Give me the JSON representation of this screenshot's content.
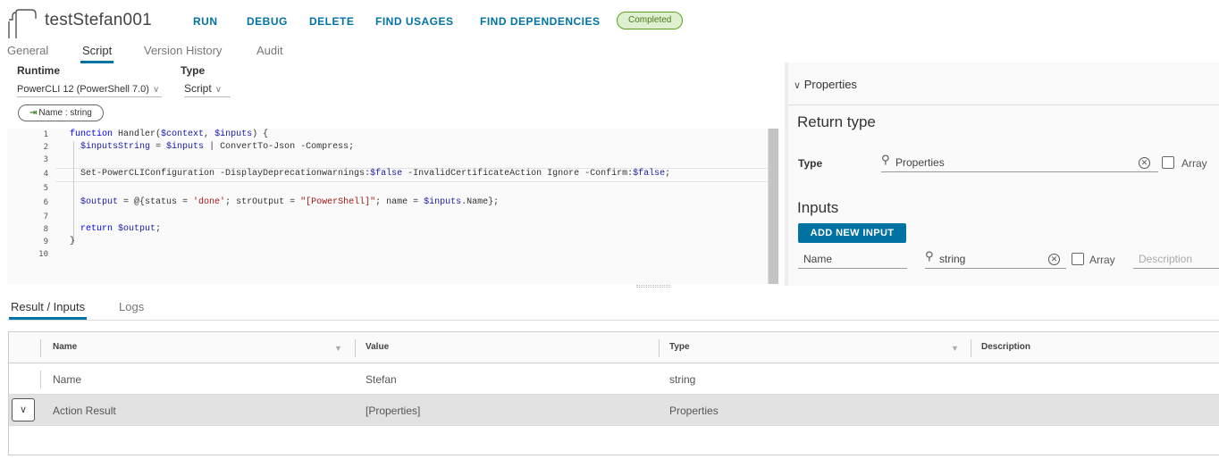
{
  "header": {
    "title": "testStefan001",
    "buttons": [
      "RUN",
      "DEBUG",
      "DELETE",
      "FIND USAGES",
      "FIND DEPENDENCIES"
    ],
    "status": "Completed",
    "icon": "document-icon"
  },
  "tabs": [
    "General",
    "Script",
    "Version History",
    "Audit"
  ],
  "config": {
    "runtime_label": "Runtime",
    "runtime_value": "PowerCLI 12 (PowerShell 7.0)",
    "type_label": "Type",
    "type_value": "Script",
    "input_pill": "Name : string"
  },
  "editor": {
    "line_numbers": [
      "1",
      "2",
      "3",
      "4",
      "5",
      "6",
      "7",
      "8",
      "9",
      "10"
    ]
  },
  "properties": {
    "header": "Properties",
    "return_type_heading": "Return type",
    "type_label": "Type",
    "type_value": "Properties",
    "array_label": "Array",
    "inputs_heading": "Inputs",
    "add_input_label": "ADD NEW INPUT",
    "input_name": "Name",
    "input_type": "string",
    "input_array_label": "Array",
    "description_placeholder": "Description"
  },
  "bottom_tabs": [
    "Result / Inputs",
    "Logs"
  ],
  "grid": {
    "columns": [
      "Name",
      "Value",
      "Type",
      "Description"
    ],
    "rows": [
      {
        "name": "Name",
        "value": "Stefan",
        "type": "string"
      },
      {
        "name": "Action Result",
        "value": "[Properties]",
        "type": "Properties"
      }
    ]
  },
  "colors": {
    "accent": "#0072a3",
    "status_bg": "#dff0d0",
    "status_border": "#5aa220"
  }
}
